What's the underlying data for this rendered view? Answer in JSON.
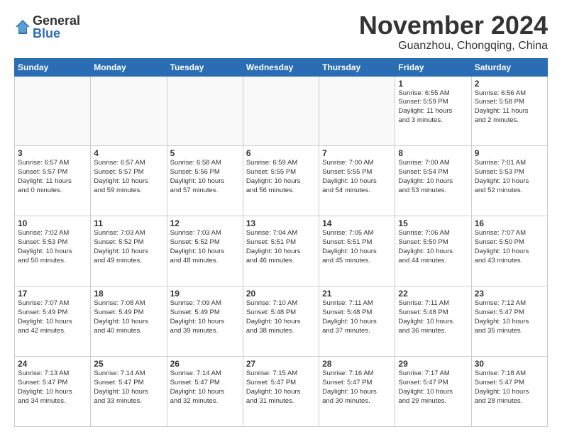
{
  "logo": {
    "general": "General",
    "blue": "Blue"
  },
  "title": "November 2024",
  "location": "Guanzhou, Chongqing, China",
  "days_header": [
    "Sunday",
    "Monday",
    "Tuesday",
    "Wednesday",
    "Thursday",
    "Friday",
    "Saturday"
  ],
  "weeks": [
    [
      {
        "day": "",
        "text": ""
      },
      {
        "day": "",
        "text": ""
      },
      {
        "day": "",
        "text": ""
      },
      {
        "day": "",
        "text": ""
      },
      {
        "day": "",
        "text": ""
      },
      {
        "day": "1",
        "text": "Sunrise: 6:55 AM\nSunset: 5:59 PM\nDaylight: 11 hours\nand 3 minutes."
      },
      {
        "day": "2",
        "text": "Sunrise: 6:56 AM\nSunset: 5:58 PM\nDaylight: 11 hours\nand 2 minutes."
      }
    ],
    [
      {
        "day": "3",
        "text": "Sunrise: 6:57 AM\nSunset: 5:57 PM\nDaylight: 11 hours\nand 0 minutes."
      },
      {
        "day": "4",
        "text": "Sunrise: 6:57 AM\nSunset: 5:57 PM\nDaylight: 10 hours\nand 59 minutes."
      },
      {
        "day": "5",
        "text": "Sunrise: 6:58 AM\nSunset: 5:56 PM\nDaylight: 10 hours\nand 57 minutes."
      },
      {
        "day": "6",
        "text": "Sunrise: 6:59 AM\nSunset: 5:55 PM\nDaylight: 10 hours\nand 56 minutes."
      },
      {
        "day": "7",
        "text": "Sunrise: 7:00 AM\nSunset: 5:55 PM\nDaylight: 10 hours\nand 54 minutes."
      },
      {
        "day": "8",
        "text": "Sunrise: 7:00 AM\nSunset: 5:54 PM\nDaylight: 10 hours\nand 53 minutes."
      },
      {
        "day": "9",
        "text": "Sunrise: 7:01 AM\nSunset: 5:53 PM\nDaylight: 10 hours\nand 52 minutes."
      }
    ],
    [
      {
        "day": "10",
        "text": "Sunrise: 7:02 AM\nSunset: 5:53 PM\nDaylight: 10 hours\nand 50 minutes."
      },
      {
        "day": "11",
        "text": "Sunrise: 7:03 AM\nSunset: 5:52 PM\nDaylight: 10 hours\nand 49 minutes."
      },
      {
        "day": "12",
        "text": "Sunrise: 7:03 AM\nSunset: 5:52 PM\nDaylight: 10 hours\nand 48 minutes."
      },
      {
        "day": "13",
        "text": "Sunrise: 7:04 AM\nSunset: 5:51 PM\nDaylight: 10 hours\nand 46 minutes."
      },
      {
        "day": "14",
        "text": "Sunrise: 7:05 AM\nSunset: 5:51 PM\nDaylight: 10 hours\nand 45 minutes."
      },
      {
        "day": "15",
        "text": "Sunrise: 7:06 AM\nSunset: 5:50 PM\nDaylight: 10 hours\nand 44 minutes."
      },
      {
        "day": "16",
        "text": "Sunrise: 7:07 AM\nSunset: 5:50 PM\nDaylight: 10 hours\nand 43 minutes."
      }
    ],
    [
      {
        "day": "17",
        "text": "Sunrise: 7:07 AM\nSunset: 5:49 PM\nDaylight: 10 hours\nand 42 minutes."
      },
      {
        "day": "18",
        "text": "Sunrise: 7:08 AM\nSunset: 5:49 PM\nDaylight: 10 hours\nand 40 minutes."
      },
      {
        "day": "19",
        "text": "Sunrise: 7:09 AM\nSunset: 5:49 PM\nDaylight: 10 hours\nand 39 minutes."
      },
      {
        "day": "20",
        "text": "Sunrise: 7:10 AM\nSunset: 5:48 PM\nDaylight: 10 hours\nand 38 minutes."
      },
      {
        "day": "21",
        "text": "Sunrise: 7:11 AM\nSunset: 5:48 PM\nDaylight: 10 hours\nand 37 minutes."
      },
      {
        "day": "22",
        "text": "Sunrise: 7:11 AM\nSunset: 5:48 PM\nDaylight: 10 hours\nand 36 minutes."
      },
      {
        "day": "23",
        "text": "Sunrise: 7:12 AM\nSunset: 5:47 PM\nDaylight: 10 hours\nand 35 minutes."
      }
    ],
    [
      {
        "day": "24",
        "text": "Sunrise: 7:13 AM\nSunset: 5:47 PM\nDaylight: 10 hours\nand 34 minutes."
      },
      {
        "day": "25",
        "text": "Sunrise: 7:14 AM\nSunset: 5:47 PM\nDaylight: 10 hours\nand 33 minutes."
      },
      {
        "day": "26",
        "text": "Sunrise: 7:14 AM\nSunset: 5:47 PM\nDaylight: 10 hours\nand 32 minutes."
      },
      {
        "day": "27",
        "text": "Sunrise: 7:15 AM\nSunset: 5:47 PM\nDaylight: 10 hours\nand 31 minutes."
      },
      {
        "day": "28",
        "text": "Sunrise: 7:16 AM\nSunset: 5:47 PM\nDaylight: 10 hours\nand 30 minutes."
      },
      {
        "day": "29",
        "text": "Sunrise: 7:17 AM\nSunset: 5:47 PM\nDaylight: 10 hours\nand 29 minutes."
      },
      {
        "day": "30",
        "text": "Sunrise: 7:18 AM\nSunset: 5:47 PM\nDaylight: 10 hours\nand 28 minutes."
      }
    ]
  ]
}
